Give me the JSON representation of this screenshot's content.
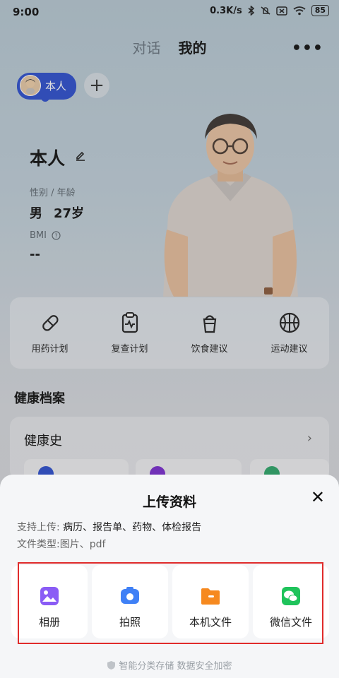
{
  "status_bar": {
    "time": "9:00",
    "net_speed": "0.3K/s",
    "battery": "85"
  },
  "header": {
    "tabs": [
      {
        "label": "对话"
      },
      {
        "label": "我的"
      }
    ],
    "more_label": "•••"
  },
  "profile": {
    "chip_label": "本人",
    "name": "本人",
    "gender_age_label": "性别 / 年龄",
    "gender": "男",
    "age": "27岁",
    "bmi_label": "BMI",
    "bmi_value": "--"
  },
  "quick_actions": [
    {
      "label": "用药计划",
      "icon": "pill-icon"
    },
    {
      "label": "复查计划",
      "icon": "clipboard-pulse-icon"
    },
    {
      "label": "饮食建议",
      "icon": "cup-icon"
    },
    {
      "label": "运动建议",
      "icon": "basketball-icon"
    }
  ],
  "health": {
    "section_title": "健康档案",
    "history_label": "健康史"
  },
  "upload_sheet": {
    "title": "上传资料",
    "support_prefix": "支持上传:",
    "support_items": "病历、报告单、药物、体检报告",
    "type_prefix": "文件类型:",
    "type_items": "图片、pdf",
    "options": [
      {
        "label": "相册",
        "icon": "album-icon",
        "color": "#8a5cf5"
      },
      {
        "label": "拍照",
        "icon": "camera-icon",
        "color": "#3f80f6"
      },
      {
        "label": "本机文件",
        "icon": "folder-icon",
        "color": "#f6891f"
      },
      {
        "label": "微信文件",
        "icon": "wechat-icon",
        "color": "#1fc35b"
      }
    ],
    "footer": "智能分类存储 数据安全加密"
  }
}
